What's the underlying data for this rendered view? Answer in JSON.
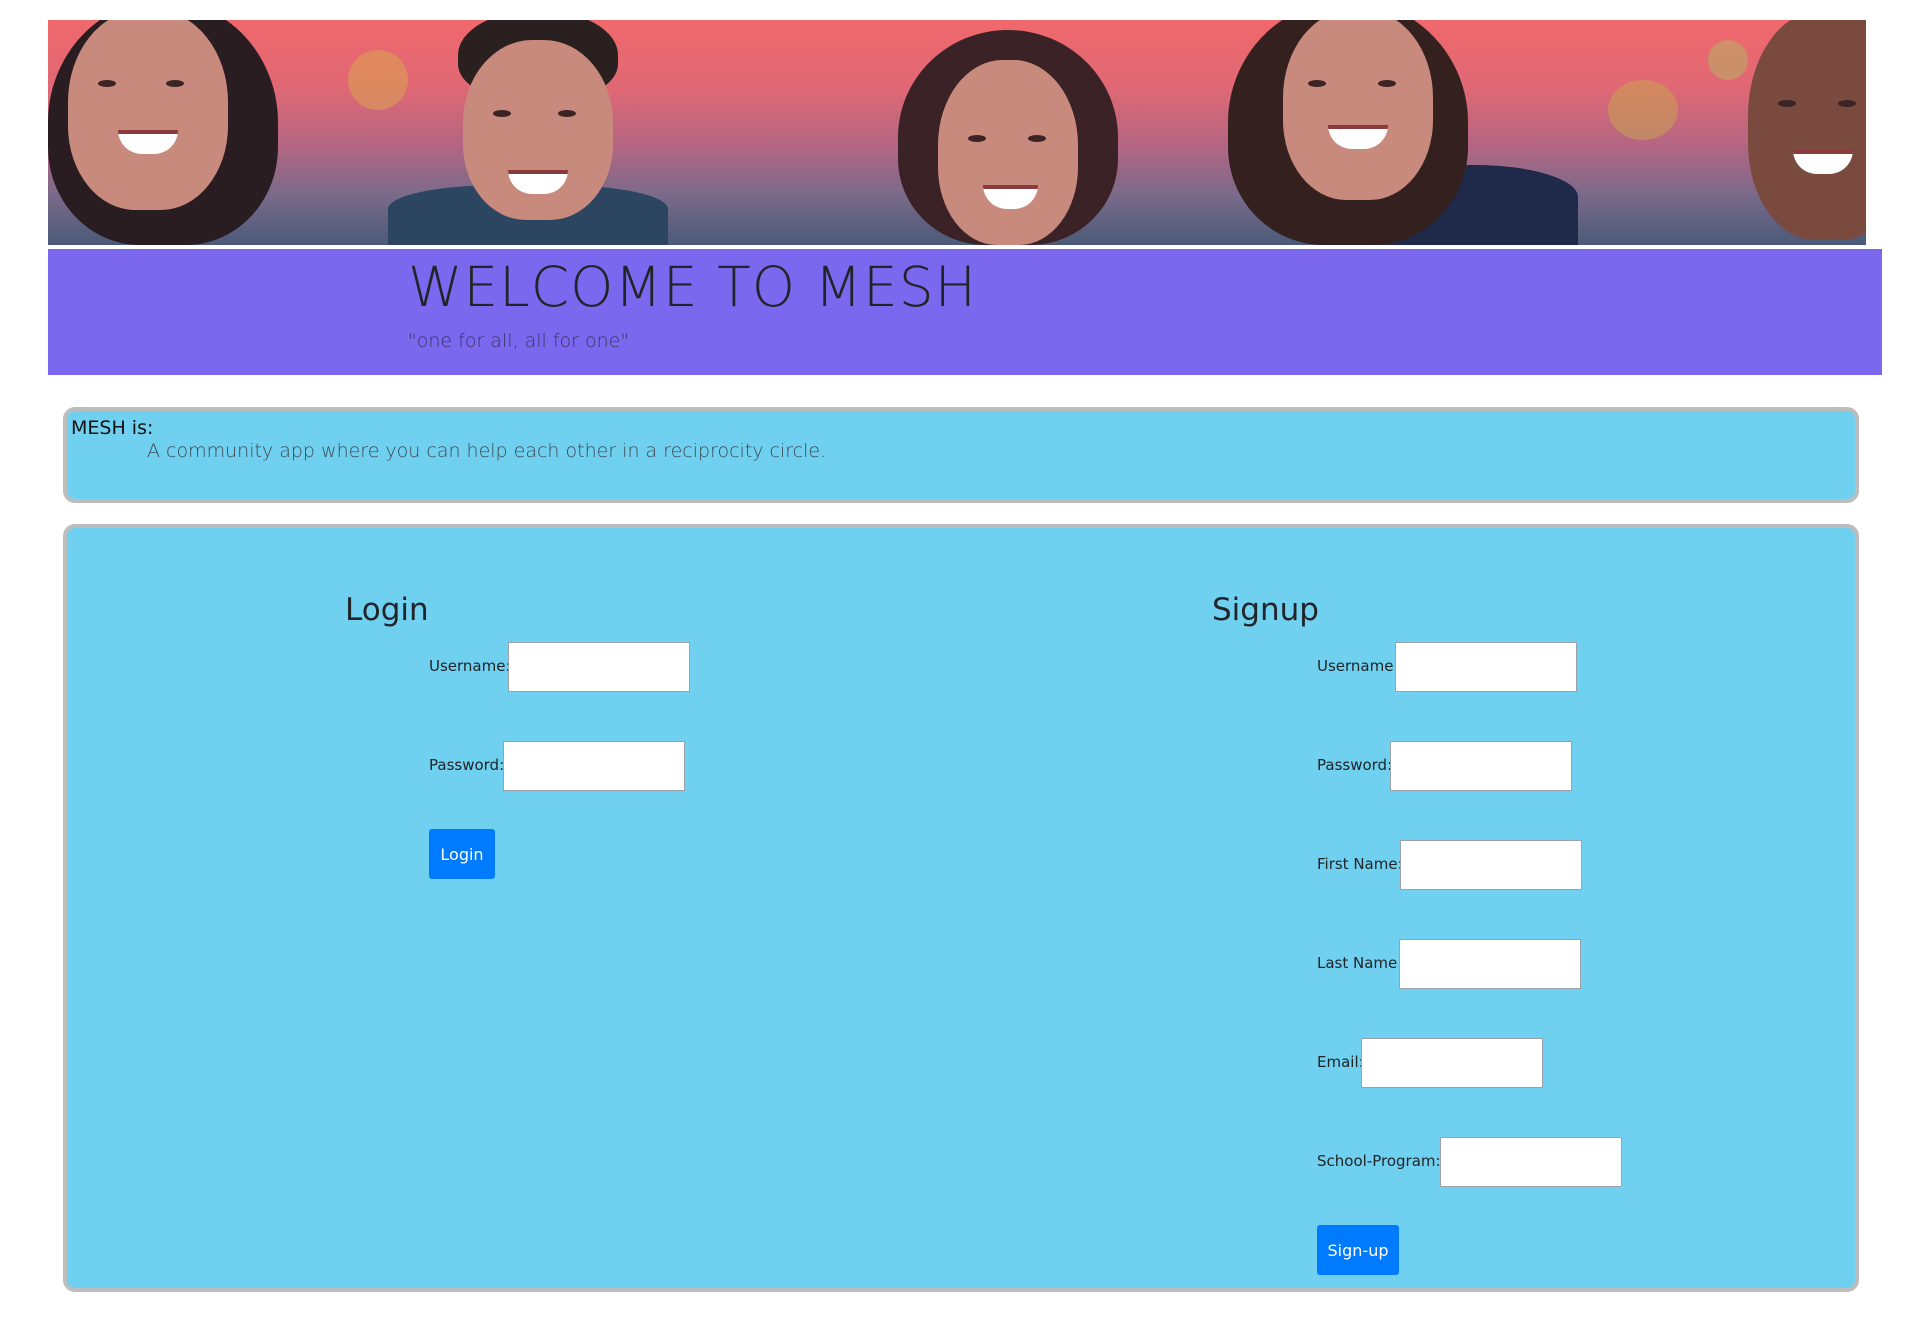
{
  "banner": {
    "title": "WELCOME TO MESH",
    "tagline": "\"one for all, all for one\""
  },
  "about": {
    "heading": "MESH is:",
    "description": "A community app where you can help each other in a reciprocity circle."
  },
  "login": {
    "title": "Login",
    "username_label": "Username:",
    "username_value": "",
    "password_label": "Password:",
    "password_value": "",
    "button_label": "Login"
  },
  "signup": {
    "title": "Signup",
    "username_label": "Username:",
    "password_label": "Password:",
    "first_name_label": "First Name:",
    "last_name_label": "Last Name:",
    "email_label": "Email:",
    "school_program_label": "School-Program:",
    "button_label": "Sign-up"
  },
  "colors": {
    "banner_bg": "#7b68ee",
    "panel_bg": "#70d0f0",
    "button_bg": "#007bff"
  }
}
